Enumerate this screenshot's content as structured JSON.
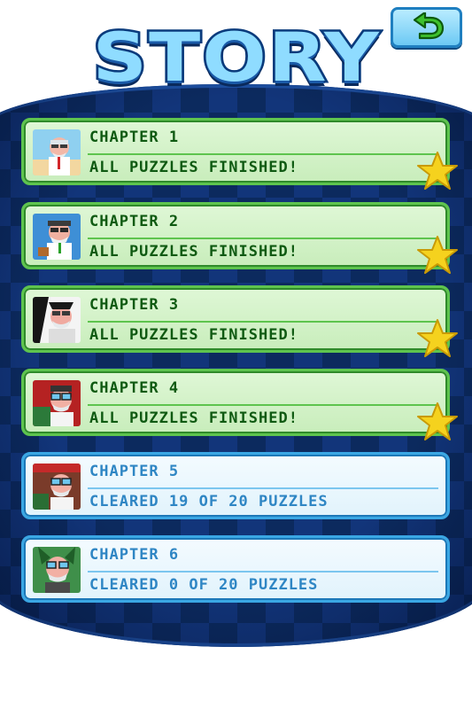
{
  "title": "STORY",
  "back_button": {
    "icon": "back-arrow-icon"
  },
  "chapters": [
    {
      "name": "CHAPTER 1",
      "status": "ALL PUZZLES FINISHED!",
      "state": "complete",
      "star": true
    },
    {
      "name": "CHAPTER 2",
      "status": "ALL PUZZLES FINISHED!",
      "state": "complete",
      "star": true
    },
    {
      "name": "CHAPTER 3",
      "status": "ALL PUZZLES FINISHED!",
      "state": "complete",
      "star": true
    },
    {
      "name": "CHAPTER 4",
      "status": "ALL PUZZLES FINISHED!",
      "state": "complete",
      "star": true
    },
    {
      "name": "CHAPTER 5",
      "status": "CLEARED 19 OF 20 PUZZLES",
      "state": "in-progress",
      "star": false
    },
    {
      "name": "CHAPTER 6",
      "status": "CLEARED 0 OF 20 PUZZLES",
      "state": "in-progress",
      "star": false
    }
  ],
  "colors": {
    "complete_fill": "#d4f2c8",
    "complete_border": "#5ec44e",
    "complete_text": "#0f5a12",
    "progress_fill": "#eaf7fd",
    "progress_border": "#3aa7e4",
    "progress_text": "#2f86c4",
    "star": "#f5d21e"
  }
}
